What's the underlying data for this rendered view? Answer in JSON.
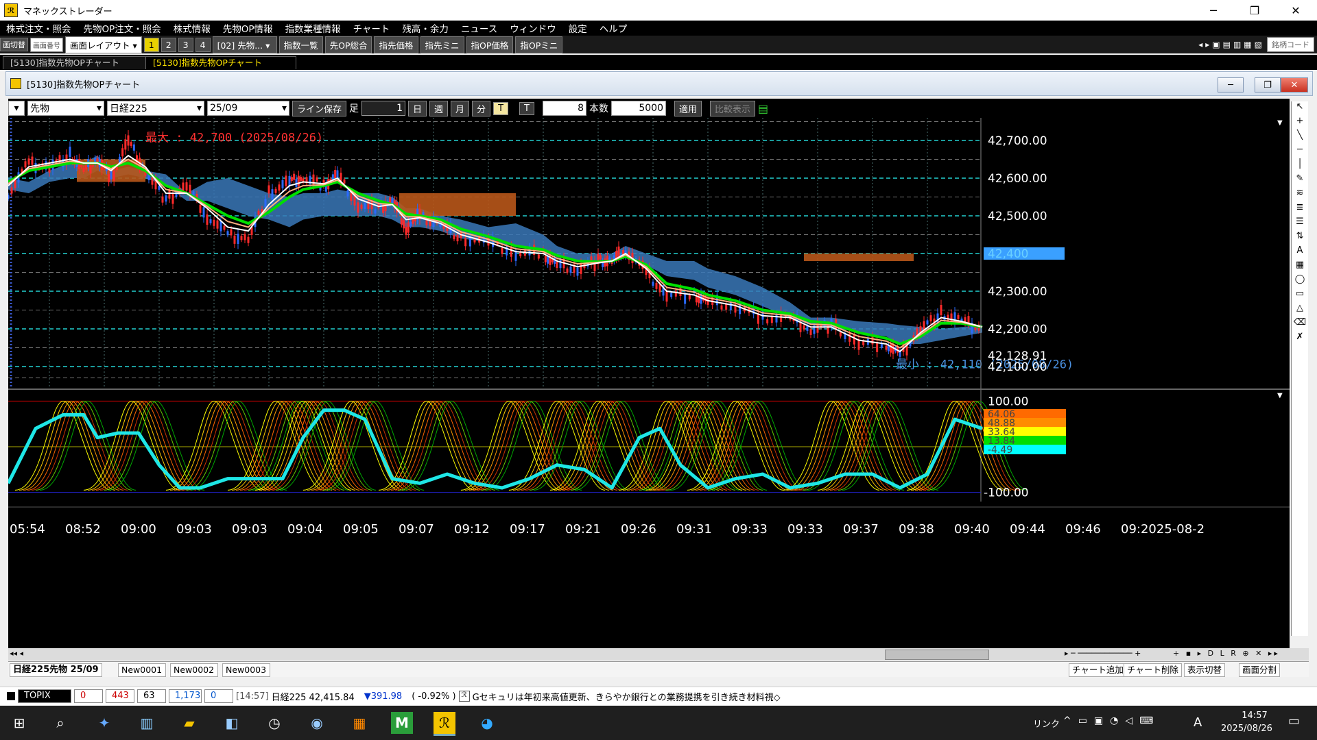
{
  "window": {
    "title": "マネックストレーダー",
    "minimize": "─",
    "maximize": "❐",
    "close": "✕"
  },
  "menu": [
    "株式注文・照会",
    "先物OP注文・照会",
    "株式情報",
    "先物OP情報",
    "指数業種情報",
    "チャート",
    "残高・余力",
    "ニュース",
    "ウィンドウ",
    "設定",
    "ヘルプ"
  ],
  "toolbar": {
    "switch": "画切替",
    "screen_no": "画面番号",
    "layout": "画面レイアウト",
    "layout_nums": [
      "1",
      "2",
      "3",
      "4"
    ],
    "screen_select": "[02] 先物...",
    "buttons": [
      "指数一覧",
      "先OP総合",
      "指先価格",
      "指先ミニ",
      "指OP価格",
      "指OPミニ"
    ],
    "code_box": "銘柄コード"
  },
  "window_tabs": [
    "[5130]指数先物OPチャート",
    "[5130]指数先物OPチャート"
  ],
  "inner_window": {
    "title": "[5130]指数先物OPチャート"
  },
  "chart_toolbar": {
    "type_select": "先物",
    "index_select": "日経225",
    "month_select": "25/09",
    "line_save": "ライン保存",
    "ashi_label": "足",
    "ashi_value": "1",
    "periods": [
      "日",
      "週",
      "月",
      "分",
      "T"
    ],
    "t_label": "T",
    "t_value": "8",
    "honsu_label": "本数",
    "honsu_value": "5000",
    "apply": "適用",
    "compare": "比較表示"
  },
  "chart_data": [
    {
      "type": "candlestick",
      "instrument": "日経225先物 25/09",
      "y_ticks": [
        "42,700.00",
        "42,600.00",
        "42,500.00",
        "42,400",
        "42,300.00",
        "42,200.00",
        "42,128.91",
        "42,100.00"
      ],
      "ylim": [
        42040,
        42760
      ],
      "current_price_label": "42,400",
      "last_value_label": "42,128.91",
      "max_annotation": "最大 : 42,700 (2025/08/26)",
      "min_annotation": "最小 : 42,110 (2025/08/26)",
      "price_path": {
        "x": [
          0,
          30,
          60,
          90,
          110,
          130,
          150,
          175,
          200,
          230,
          260,
          290,
          320,
          350,
          380,
          410,
          430,
          460,
          480,
          510,
          540,
          560,
          580,
          600,
          630,
          660,
          700,
          740,
          780,
          800,
          830,
          860,
          880,
          900,
          930,
          960,
          1000,
          1020,
          1060,
          1100,
          1140,
          1170,
          1200,
          1240,
          1280,
          1300,
          1330,
          1360,
          1390,
          1420
        ],
        "close": [
          42560,
          42640,
          42630,
          42660,
          42620,
          42650,
          42600,
          42700,
          42620,
          42540,
          42580,
          42500,
          42450,
          42440,
          42560,
          42590,
          42600,
          42580,
          42610,
          42530,
          42520,
          42540,
          42470,
          42500,
          42480,
          42440,
          42430,
          42400,
          42400,
          42370,
          42360,
          42380,
          42380,
          42410,
          42350,
          42290,
          42290,
          42270,
          42260,
          42230,
          42230,
          42200,
          42210,
          42160,
          42160,
          42130,
          42200,
          42240,
          42220,
          42200
        ]
      },
      "ma_fast_y": [
        42580,
        42630,
        42640,
        42650,
        42640,
        42640,
        42620,
        42660,
        42630,
        42560,
        42560,
        42520,
        42470,
        42460,
        42530,
        42580,
        42590,
        42585,
        42600,
        42545,
        42525,
        42530,
        42490,
        42495,
        42480,
        42450,
        42430,
        42405,
        42400,
        42380,
        42365,
        42375,
        42380,
        42400,
        42360,
        42300,
        42290,
        42275,
        42262,
        42235,
        42230,
        42205,
        42205,
        42170,
        42160,
        42140,
        42190,
        42230,
        42220,
        42205
      ],
      "ma_green_y": [
        42590,
        42620,
        42630,
        42640,
        42640,
        42640,
        42630,
        42640,
        42620,
        42580,
        42560,
        42530,
        42500,
        42480,
        42510,
        42550,
        42570,
        42580,
        42590,
        42560,
        42540,
        42530,
        42505,
        42500,
        42490,
        42465,
        42445,
        42420,
        42410,
        42395,
        42380,
        42378,
        42380,
        42392,
        42370,
        42320,
        42305,
        42290,
        42275,
        42250,
        42240,
        42220,
        42215,
        42190,
        42175,
        42160,
        42180,
        42215,
        42215,
        42205
      ],
      "cloud_upper": [
        42600,
        42590,
        42620,
        42640,
        42640,
        42660,
        42620,
        42630,
        42620,
        42610,
        42560,
        42590,
        42600,
        42580,
        42560,
        42550,
        42560,
        42560,
        42570,
        42560,
        42560,
        42550,
        42520,
        42520,
        42500,
        42490,
        42470,
        42480,
        42450,
        42420,
        42400,
        42400,
        42400,
        42420,
        42400,
        42380,
        42380,
        42360,
        42340,
        42310,
        42270,
        42230,
        42230,
        42220,
        42215,
        42210,
        42205,
        42200,
        42205,
        42210
      ],
      "cloud_lower": [
        42570,
        42560,
        42590,
        42600,
        42600,
        42620,
        42600,
        42610,
        42600,
        42580,
        42540,
        42540,
        42520,
        42500,
        42490,
        42470,
        42490,
        42500,
        42500,
        42500,
        42500,
        42490,
        42470,
        42470,
        42460,
        42440,
        42430,
        42420,
        42410,
        42390,
        42380,
        42380,
        42380,
        42390,
        42370,
        42340,
        42330,
        42310,
        42290,
        42260,
        42230,
        42210,
        42205,
        42190,
        42180,
        42160,
        42160,
        42170,
        42180,
        42190
      ]
    },
    {
      "type": "line",
      "indicator": "oscillator",
      "y_ticks": [
        "100.00",
        "-100.00"
      ],
      "ylim": [
        -120,
        120
      ],
      "value_labels": [
        "64.06",
        "48.88",
        "33.64",
        "13.84",
        "-4.49"
      ],
      "value_colors": [
        "#ff6a00",
        "#ff8c00",
        "#ffff00",
        "#00dd00",
        "#00ffff"
      ],
      "main_x": [
        0,
        40,
        80,
        110,
        130,
        160,
        190,
        220,
        250,
        280,
        320,
        360,
        400,
        430,
        460,
        490,
        520,
        560,
        600,
        640,
        680,
        720,
        760,
        800,
        840,
        880,
        920,
        950,
        980,
        1020,
        1060,
        1100,
        1140,
        1180,
        1220,
        1260,
        1300,
        1340,
        1380,
        1420
      ],
      "main_y": [
        -80,
        40,
        70,
        70,
        20,
        30,
        30,
        -40,
        -90,
        -90,
        -70,
        -70,
        -70,
        20,
        80,
        80,
        60,
        -70,
        -80,
        -60,
        -80,
        -90,
        -70,
        -40,
        -50,
        -90,
        20,
        40,
        -40,
        -90,
        -70,
        -60,
        -90,
        -80,
        -60,
        -60,
        -90,
        -60,
        60,
        40
      ],
      "thin_peaks_x": [
        80,
        180,
        300,
        390,
        430,
        500,
        610,
        730,
        800,
        860,
        960,
        1000,
        1060,
        1200,
        1250,
        1380
      ]
    }
  ],
  "x_ticks": [
    "05:54",
    "08:52",
    "09:00",
    "09:03",
    "09:03",
    "09:04",
    "09:05",
    "09:07",
    "09:12",
    "09:17",
    "09:21",
    "09:26",
    "09:31",
    "09:33",
    "09:33",
    "09:37",
    "09:38",
    "09:40",
    "09:44",
    "09:46",
    "09:2025-08-2"
  ],
  "bottom_tabs": [
    "日経225先物 25/09",
    "New0001",
    "New0002",
    "New0003"
  ],
  "bottom_buttons": [
    "チャート追加",
    "チャート削除",
    "表示切替",
    "画面分割"
  ],
  "status_bar": {
    "index_name": "TOPIX",
    "box1": "0",
    "box2": "443",
    "box3": "63",
    "box4": "1,173",
    "box5": "0",
    "time": "[14:57]",
    "nikkei": "日経225 42,415.84",
    "change": "▼391.98",
    "change_pct": "( -0.92% )",
    "news": "Gセキュリは年初来高値更新、きらやか銀行との業務提携を引き続き材料視◇"
  },
  "taskbar": {
    "time": "14:57",
    "date": "2025/08/26",
    "ime": "A",
    "link": "リンク"
  },
  "colors": {
    "background": "#000000",
    "grid": "#4a7070",
    "ma_fast": "#ffffff",
    "ma_green": "#00e000",
    "cloud_blue": "#3a78b8",
    "cloud_brown": "#b8561a",
    "main_line": "#1ee6e6",
    "max_text": "#ff3030",
    "min_text": "#4a90e0"
  }
}
